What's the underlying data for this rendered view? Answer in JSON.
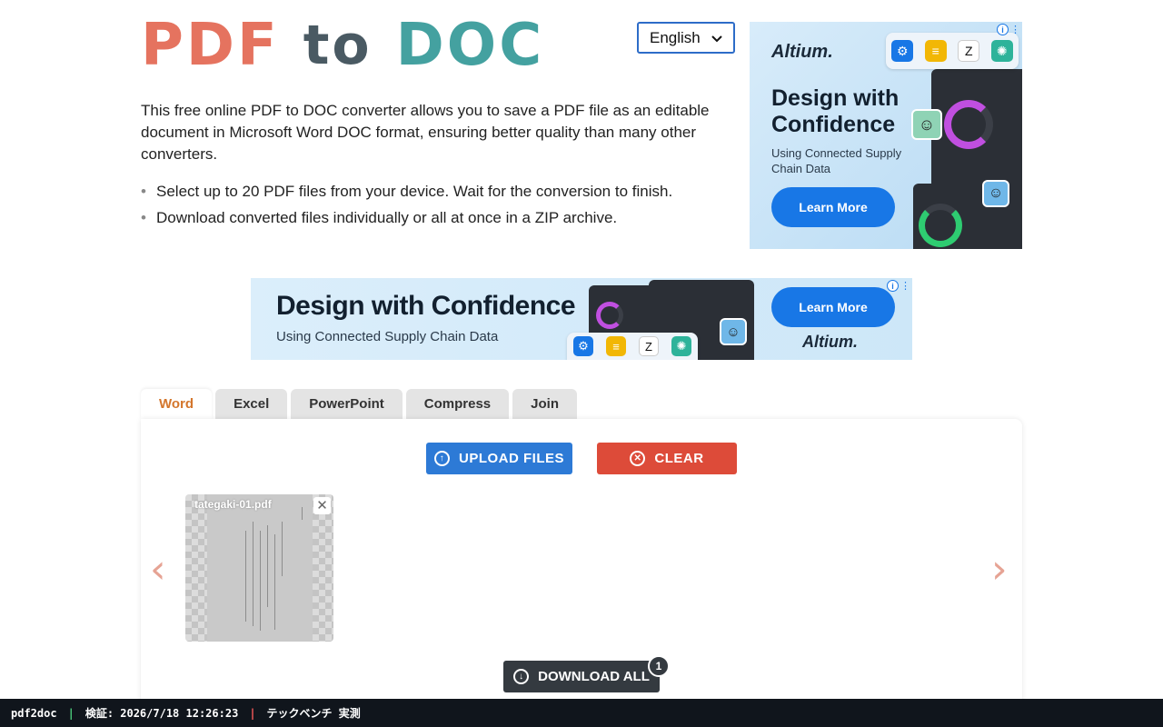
{
  "logo": {
    "part1": "PDF",
    "part2": "to",
    "part3": "DOC"
  },
  "language": {
    "selected": "English"
  },
  "intro": {
    "text": "This free online PDF to DOC converter allows you to save a PDF file as an editable document in Microsoft Word DOC format, ensuring better quality than many other converters.",
    "bullets": [
      "Select up to 20 PDF files from your device. Wait for the conversion to finish.",
      "Download converted files individually or all at once in a ZIP archive."
    ]
  },
  "ad_side": {
    "brand": "Altium.",
    "headline": "Design with Confidence",
    "sub": "Using Connected Supply Chain Data",
    "cta": "Learn More"
  },
  "ad_banner": {
    "headline": "Design with Confidence",
    "sub": "Using Connected Supply Chain Data",
    "cta": "Learn More",
    "brand": "Altium."
  },
  "tabs": [
    {
      "label": "Word",
      "active": true
    },
    {
      "label": "Excel",
      "active": false
    },
    {
      "label": "PowerPoint",
      "active": false
    },
    {
      "label": "Compress",
      "active": false
    },
    {
      "label": "Join",
      "active": false
    }
  ],
  "converter": {
    "upload_label": "UPLOAD FILES",
    "clear_label": "CLEAR",
    "download_all_label": "DOWNLOAD ALL",
    "file_count": "1",
    "files": [
      {
        "name": "tategaki-01.pdf"
      }
    ]
  },
  "colors": {
    "logo_pdf": "#e5735f",
    "logo_to": "#4a5a63",
    "logo_doc": "#44a1a0",
    "upload": "#2d7ad6",
    "clear": "#dd4b39",
    "active_tab": "#d4762c",
    "download": "#343a40"
  },
  "statusbar": {
    "app": "pdf2doc",
    "verified": "検証: 2026/7/18 12:26:23",
    "note": "テックベンチ 実測"
  }
}
